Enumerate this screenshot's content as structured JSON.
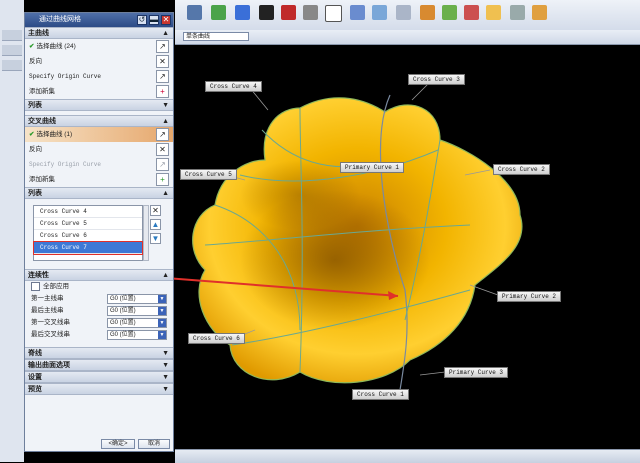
{
  "dialog": {
    "title": "通过曲线网格",
    "primary_section": "主曲线",
    "select_curve_primary": "选择曲线 (24)",
    "reverse_primary": "反向",
    "specify_origin_primary": "Specify Origin Curve",
    "add_set_primary": "添加新集",
    "list_primary": "列表",
    "cross_section": "交叉曲线",
    "select_curve_cross": "选择曲线 (1)",
    "reverse_cross": "反向",
    "specify_origin_cross": "Specify Origin Curve",
    "add_set_cross": "添加新集",
    "list_cross": "列表",
    "cross_list": [
      "Cross Curve  4",
      "Cross Curve  5",
      "Cross Curve  6",
      "Cross Curve  7"
    ],
    "continuity_section": "连续性",
    "apply_all": "全部应用",
    "continuity_rows": [
      {
        "label": "第一主线串",
        "value": "G0 (位置)"
      },
      {
        "label": "最后主线串",
        "value": "G0 (位置)"
      },
      {
        "label": "第一交叉线串",
        "value": "G0 (位置)"
      },
      {
        "label": "最后交叉线串",
        "value": "G0 (位置)"
      }
    ],
    "collapsed": [
      "脊线",
      "输出曲面选项",
      "设置",
      "预览"
    ],
    "ok": "<确定>",
    "cancel": "取消"
  },
  "toolbar": {
    "filter_value": "单条曲线"
  },
  "viewport_labels": {
    "cross4": "Cross Curve  4",
    "cross3": "Cross Curve  3",
    "cross5": "Cross Curve  5",
    "primary1": "Primary Curve  1",
    "cross2": "Cross Curve  2",
    "primary2": "Primary Curve  2",
    "cross6": "Cross Curve  6",
    "primary3": "Primary Curve  3",
    "cross1": "Cross Curve  1"
  },
  "colors": {
    "surface": "#f4b800",
    "accent": "#e0302a",
    "curve": "#5aa08a"
  }
}
